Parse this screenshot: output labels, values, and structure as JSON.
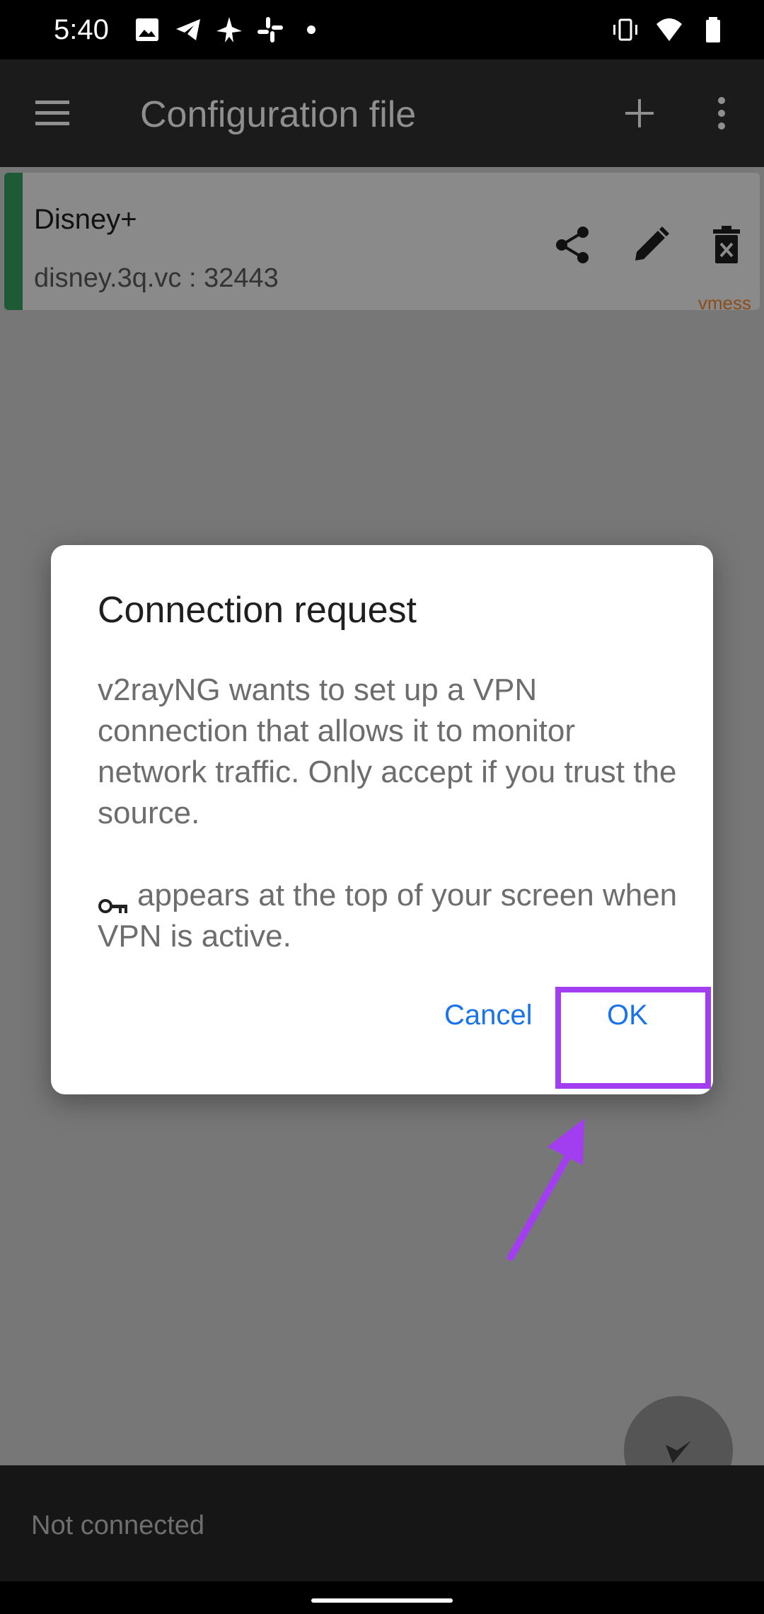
{
  "status_bar": {
    "time": "5:40",
    "left_icons": [
      "image-icon",
      "telegram-icon",
      "plane-icon",
      "slack-icon",
      "dot-icon"
    ],
    "right_icons": [
      "vibrate-icon",
      "wifi-icon",
      "battery-icon"
    ]
  },
  "toolbar": {
    "title": "Configuration file",
    "menu_icon": "hamburger-menu-icon",
    "add_icon": "plus-icon",
    "more_icon": "more-vert-icon"
  },
  "server_card": {
    "name": "Disney+",
    "address": "disney.3q.vc : 32443",
    "type": "vmess",
    "stripe_color": "#1f5a37"
  },
  "dialog": {
    "title": "Connection request",
    "message": "v2rayNG wants to set up a VPN connection that allows it to monitor network traffic. Only accept if you trust the source.",
    "message_secondary": "appears at the top of your screen when VPN is active.",
    "cancel_label": "Cancel",
    "ok_label": "OK"
  },
  "bottom": {
    "status": "Not connected"
  },
  "colors": {
    "accent": "#1a73e8",
    "highlight": "#a23ef0",
    "scrim_bg": "#777777"
  }
}
